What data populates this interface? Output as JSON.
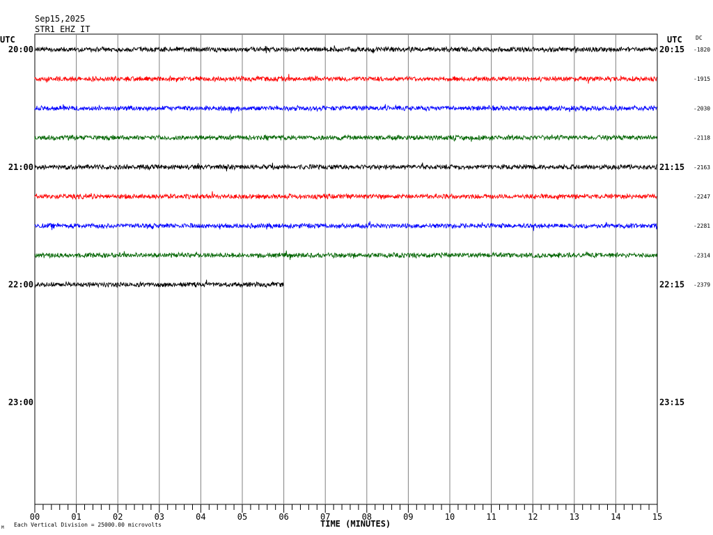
{
  "header": {
    "date": "Sep15,2025",
    "station": "STR1 EHZ IT",
    "utc_left": "UTC",
    "utc_right": "UTC",
    "dc_label": "DC"
  },
  "footer": {
    "xlabel": "TIME (MINUTES)",
    "scale_note": "Each Vertical Division = 25000.00 microvolts",
    "corner_mark": "M"
  },
  "colors": {
    "black": "#000000",
    "red": "#ff0000",
    "blue": "#0000ff",
    "green": "#006400",
    "grid": "#808080"
  },
  "chart_data": {
    "type": "line",
    "title": "STR1 EHZ IT",
    "subtitle": "Sep15,2025",
    "xlabel": "TIME (MINUTES)",
    "x_ticks": [
      "00",
      "01",
      "02",
      "03",
      "04",
      "05",
      "06",
      "07",
      "08",
      "09",
      "10",
      "11",
      "12",
      "13",
      "14",
      "15"
    ],
    "xlim": [
      0,
      15
    ],
    "grid": true,
    "left_hour_labels": [
      "20:00",
      "21:00",
      "22:00",
      "23:00"
    ],
    "right_hour_labels": [
      "20:15",
      "21:15",
      "22:15",
      "23:15"
    ],
    "traces": [
      {
        "row": 0,
        "color": "#000000",
        "dc": "-1820",
        "duration_min": 15
      },
      {
        "row": 1,
        "color": "#ff0000",
        "dc": "-1915",
        "duration_min": 15
      },
      {
        "row": 2,
        "color": "#0000ff",
        "dc": "-2030",
        "duration_min": 15
      },
      {
        "row": 3,
        "color": "#006400",
        "dc": "-2118",
        "duration_min": 15
      },
      {
        "row": 4,
        "color": "#000000",
        "dc": "-2163",
        "duration_min": 15
      },
      {
        "row": 5,
        "color": "#ff0000",
        "dc": "-2247",
        "duration_min": 15
      },
      {
        "row": 6,
        "color": "#0000ff",
        "dc": "-2281",
        "duration_min": 15
      },
      {
        "row": 7,
        "color": "#006400",
        "dc": "-2314",
        "duration_min": 15
      },
      {
        "row": 8,
        "color": "#000000",
        "dc": "-2379",
        "duration_min": 6
      }
    ]
  }
}
